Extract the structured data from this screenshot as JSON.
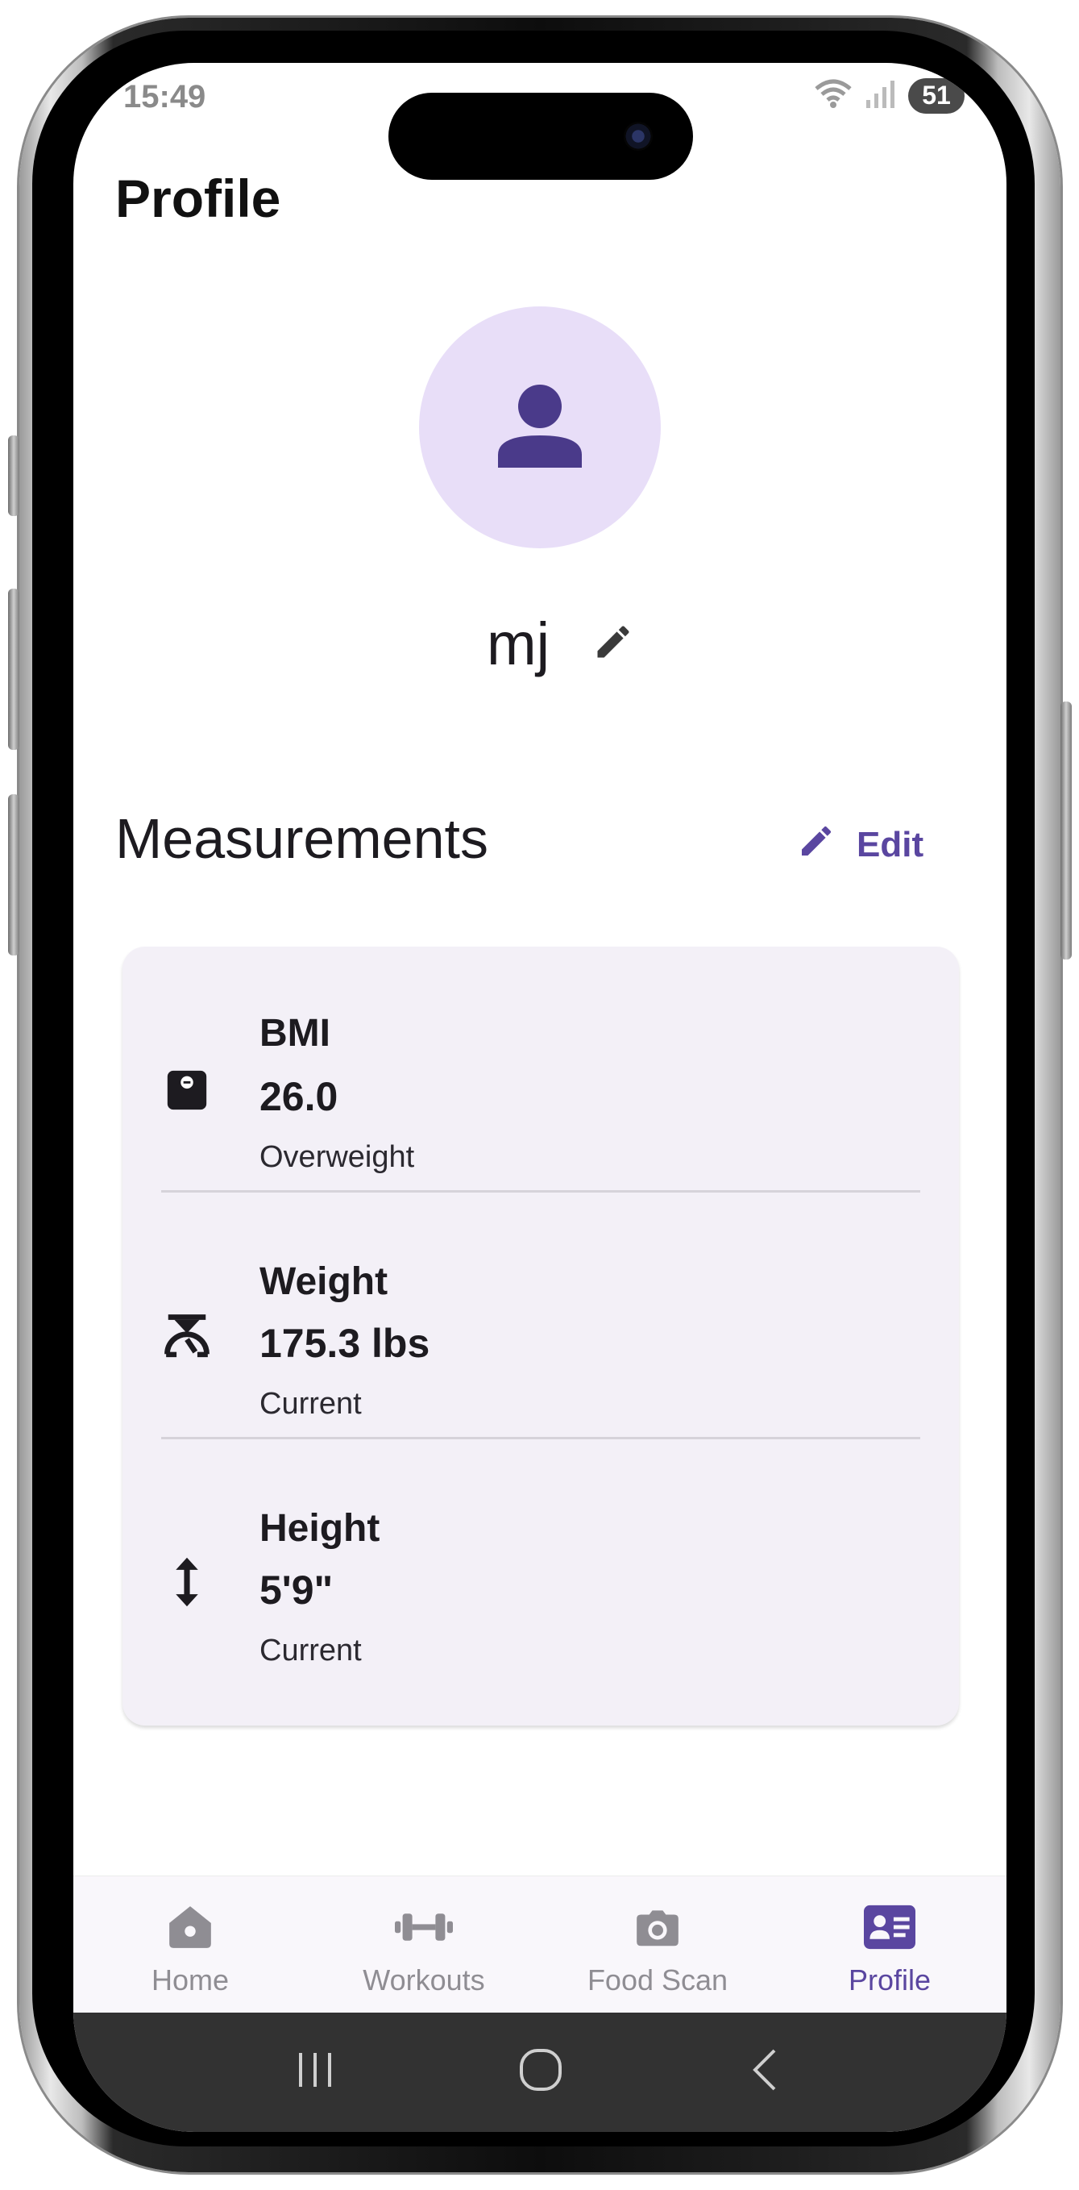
{
  "status_bar": {
    "time": "15:49",
    "battery": "51"
  },
  "header": {
    "title": "Profile"
  },
  "profile": {
    "name": "mj"
  },
  "measurements": {
    "title": "Measurements",
    "edit_label": "Edit",
    "items": [
      {
        "label": "BMI",
        "value": "26.0",
        "sub": "Overweight",
        "icon": "scale-icon"
      },
      {
        "label": "Weight",
        "value": "175.3 lbs",
        "sub": "Current",
        "icon": "weight-scale-icon"
      },
      {
        "label": "Height",
        "value": "5'9\"",
        "sub": "Current",
        "icon": "height-arrows-icon"
      }
    ]
  },
  "bottom_nav": {
    "items": [
      {
        "label": "Home",
        "icon": "home-icon",
        "active": false
      },
      {
        "label": "Workouts",
        "icon": "dumbbell-icon",
        "active": false
      },
      {
        "label": "Food Scan",
        "icon": "camera-icon",
        "active": false
      },
      {
        "label": "Profile",
        "icon": "contact-card-icon",
        "active": true
      }
    ]
  },
  "colors": {
    "accent": "#5a46a0",
    "avatar_bg": "#e8def8",
    "avatar_icon": "#4a3a8a",
    "card_bg": "#f3f0f7",
    "inactive_nav": "#8f8d93"
  }
}
